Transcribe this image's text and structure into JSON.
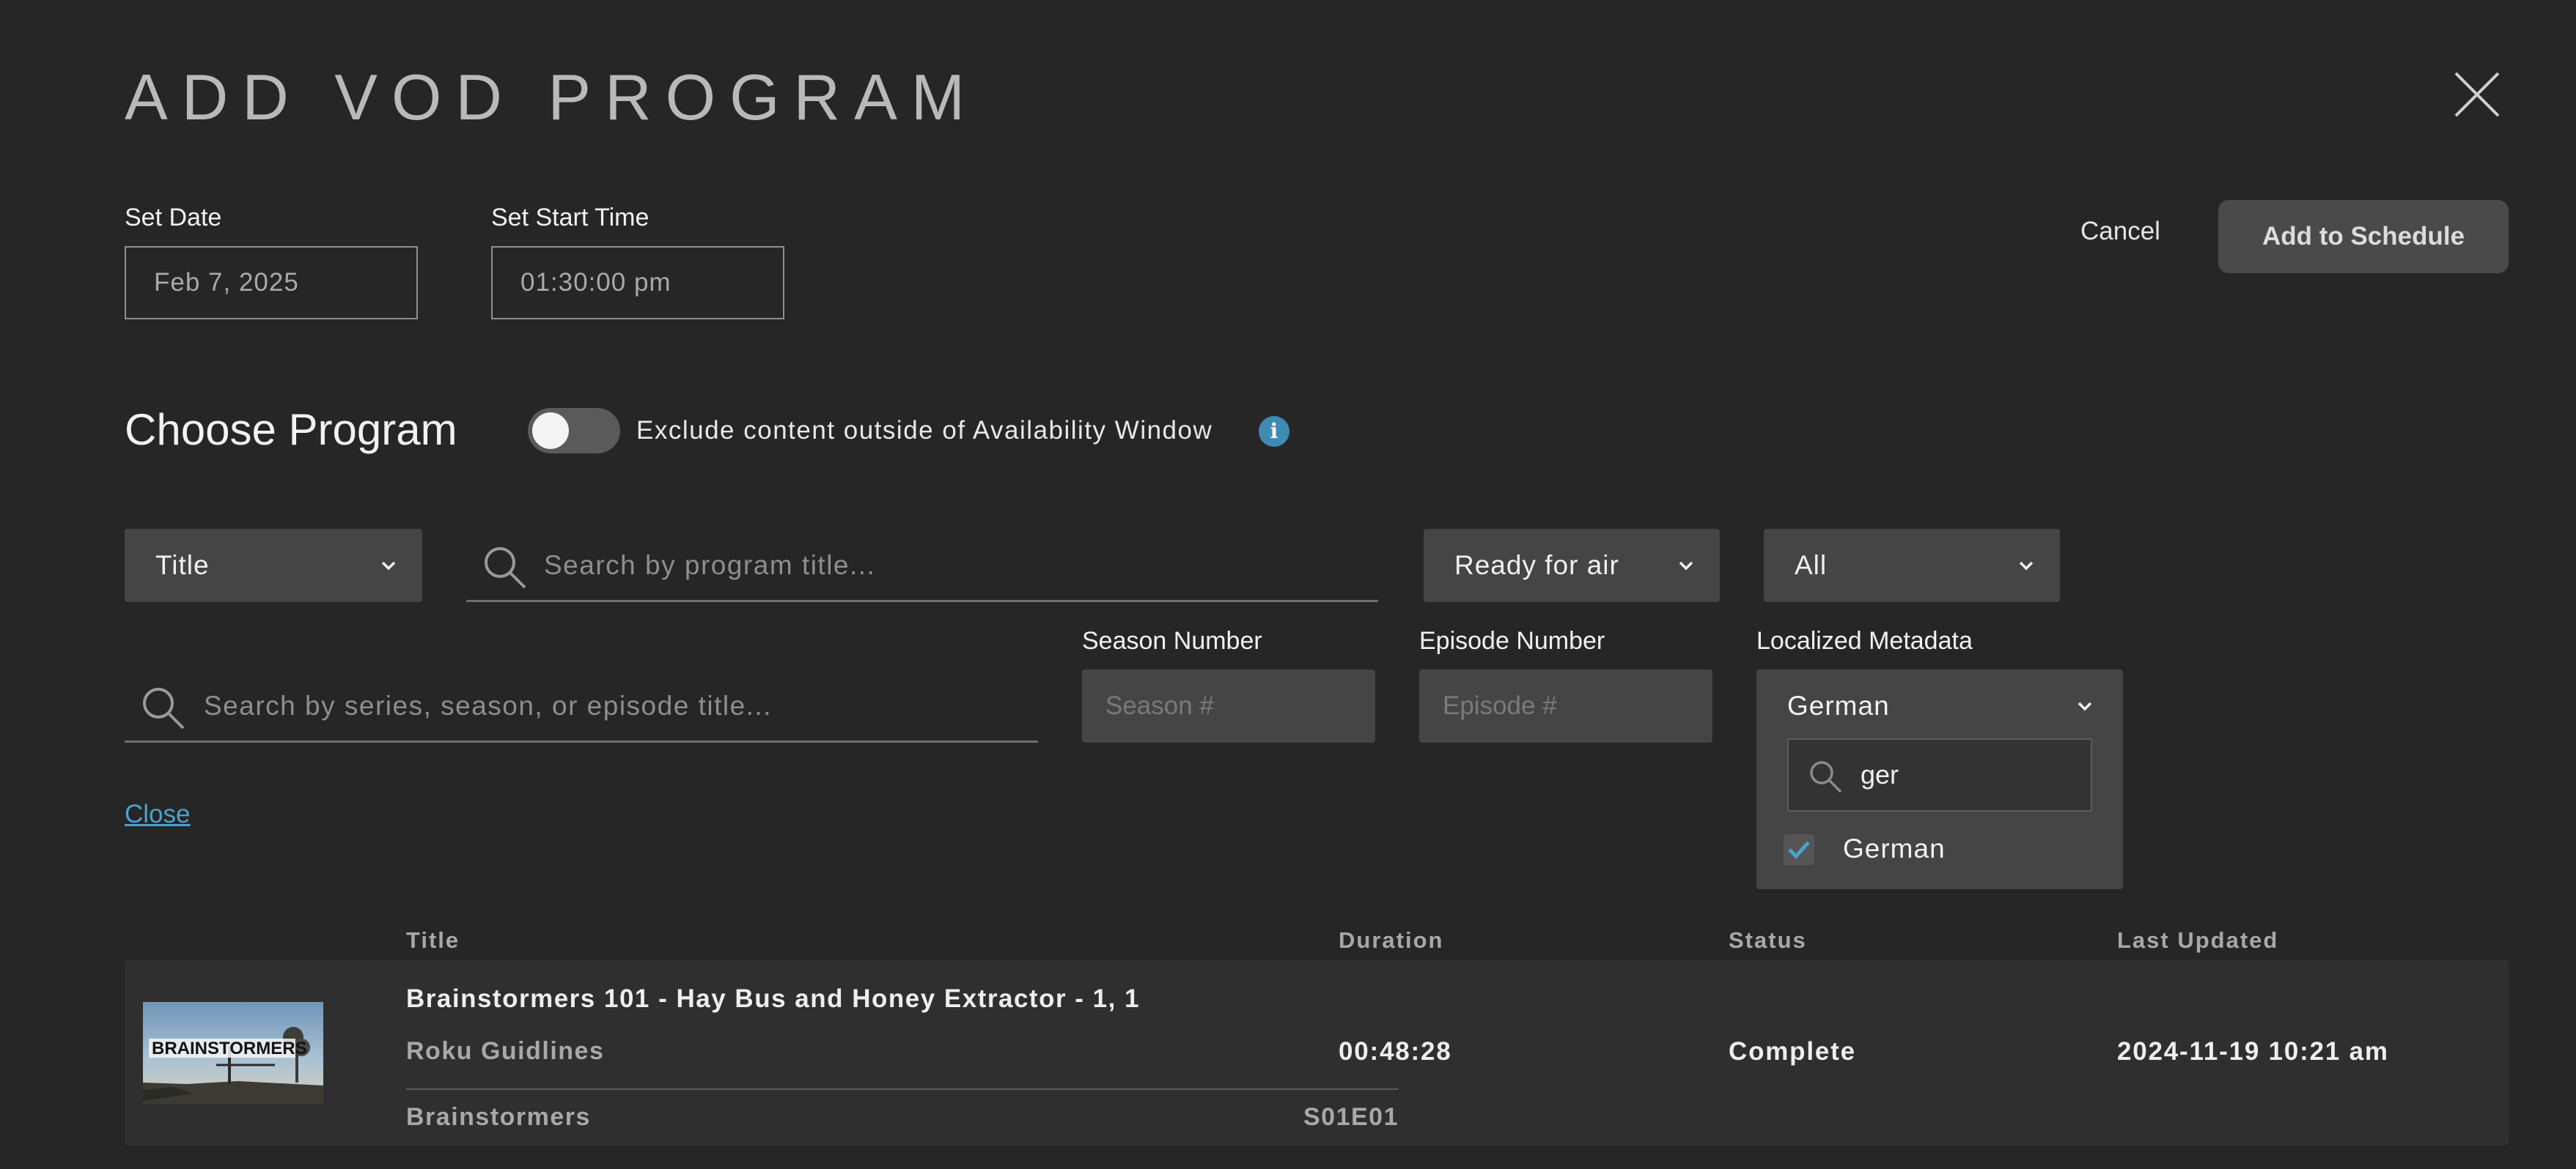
{
  "header": {
    "title": "ADD VOD PROGRAM"
  },
  "schedule": {
    "date_label": "Set Date",
    "date_value": "Feb 7, 2025",
    "time_label": "Set Start Time",
    "time_value": "01:30:00 pm",
    "cancel_label": "Cancel",
    "add_label": "Add to Schedule"
  },
  "choose": {
    "title": "Choose Program",
    "toggle_label": "Exclude content outside of Availability Window",
    "toggle_on": false,
    "info_glyph": "i"
  },
  "filters": {
    "field_select": "Title",
    "program_search_placeholder": "Search by program title...",
    "status_select": "Ready for air",
    "type_select": "All",
    "series_search_placeholder": "Search by series, season, or episode title...",
    "season_label": "Season Number",
    "season_placeholder": "Season #",
    "episode_label": "Episode Number",
    "episode_placeholder": "Episode #",
    "localized_label": "Localized Metadata",
    "localized_selected": "German",
    "localized_search_value": "ger",
    "localized_options": [
      {
        "label": "German",
        "checked": true
      }
    ],
    "close_link": "Close"
  },
  "table": {
    "columns": [
      "Title",
      "Duration",
      "Status",
      "Last Updated"
    ],
    "rows": [
      {
        "title": "Brainstormers 101 - Hay Bus and Honey Extractor - 1, 1",
        "subtitle": "Roku Guidlines",
        "series": "Brainstormers",
        "episode_code": "S01E01",
        "duration": "00:48:28",
        "status": "Complete",
        "last_updated": "2024-11-19 10:21 am",
        "thumbnail_text": "BRAINSTORMERS"
      }
    ]
  },
  "colors": {
    "background": "#262627",
    "accent_link": "#4ea0cb",
    "info_icon": "#3f8bb4",
    "control_bg": "#454546"
  }
}
